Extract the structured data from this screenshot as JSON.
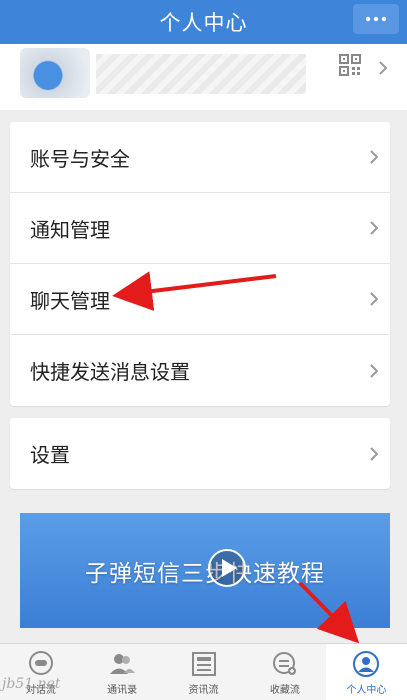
{
  "header": {
    "title": "个人中心",
    "more_icon": "more-dots-icon"
  },
  "profile": {
    "qr_icon": "qr-code-icon"
  },
  "menu_group_1": [
    {
      "label": "账号与安全"
    },
    {
      "label": "通知管理"
    },
    {
      "label": "聊天管理"
    },
    {
      "label": "快捷发送消息设置"
    }
  ],
  "menu_group_2": [
    {
      "label": "设置"
    }
  ],
  "banner": {
    "text": "子弹短信三步快速教程",
    "play_icon": "play-icon"
  },
  "tabbar": [
    {
      "label": "对话流",
      "icon": "chat-bubble-icon"
    },
    {
      "label": "通讯录",
      "icon": "contacts-icon"
    },
    {
      "label": "资讯流",
      "icon": "news-icon"
    },
    {
      "label": "收藏流",
      "icon": "favorites-icon"
    },
    {
      "label": "个人中心",
      "icon": "person-icon",
      "active": true
    }
  ],
  "watermark": "jb51.net",
  "colors": {
    "header": "#3e84d9",
    "arrow": "#e41b1b",
    "banner": "#4a8de0"
  }
}
